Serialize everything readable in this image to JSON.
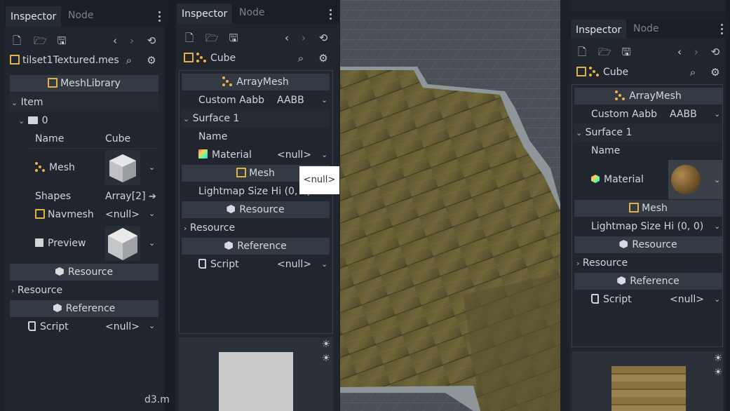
{
  "left": {
    "tabs": [
      "Inspector",
      "Node"
    ],
    "path_label": "tilset1Textured.mes",
    "section_title": "MeshLibrary",
    "item_group": "Item",
    "item_index": "0",
    "props": {
      "name_label": "Name",
      "name_value": "Cube",
      "mesh_label": "Mesh",
      "shapes_label": "Shapes",
      "shapes_value": "Array[2]",
      "navmesh_label": "Navmesh",
      "navmesh_value": "<null>",
      "preview_label": "Preview"
    },
    "resource_section": "Resource",
    "resource_group": "Resource",
    "reference_section": "Reference",
    "script_label": "Script",
    "script_value": "<null>",
    "bottom_text": "d3.m"
  },
  "middle": {
    "tabs": [
      "Inspector",
      "Node"
    ],
    "path_label": "Cube",
    "section_arraymesh": "ArrayMesh",
    "custom_aabb_label": "Custom Aabb",
    "custom_aabb_value": "AABB",
    "surface_group": "Surface 1",
    "name_label": "Name",
    "material_label": "Material",
    "material_value": "<null>",
    "mesh_section": "Mesh",
    "lightmap_label": "Lightmap Size Hi",
    "lightmap_value": "(0, 0)",
    "resource_section": "Resource",
    "resource_group": "Resource",
    "reference_section": "Reference",
    "script_label": "Script",
    "script_value": "<null>",
    "tooltip": "<null>"
  },
  "right": {
    "tabs": [
      "Inspector",
      "Node"
    ],
    "path_label": "Cube",
    "section_arraymesh": "ArrayMesh",
    "custom_aabb_label": "Custom Aabb",
    "custom_aabb_value": "AABB",
    "surface_group": "Surface 1",
    "name_label": "Name",
    "material_label": "Material",
    "mesh_section": "Mesh",
    "lightmap_label": "Lightmap Size Hi",
    "lightmap_value": "(0, 0)",
    "resource_section": "Resource",
    "resource_group": "Resource",
    "reference_section": "Reference",
    "script_label": "Script",
    "script_value": "<null>"
  },
  "colors": {
    "bg": "#21262e",
    "section": "#343a44",
    "accent": "#e0b24a",
    "wood": "#6e6436"
  }
}
